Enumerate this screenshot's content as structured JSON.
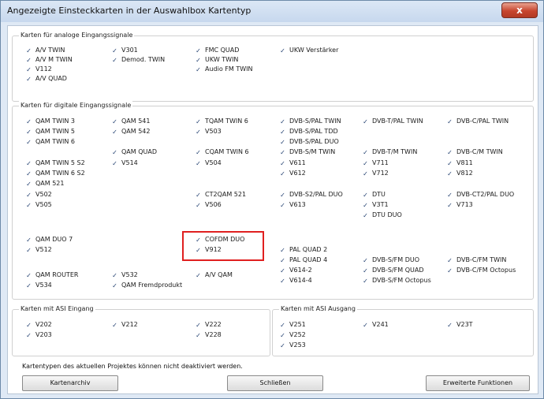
{
  "window": {
    "title": "Angezeigte Einsteckkarten in der Auswahlbox Kartentyp",
    "close_label": "x"
  },
  "check_glyph": "✓",
  "groups": {
    "analog": {
      "title": "Karten für analoge Eingangssignale"
    },
    "digital": {
      "title": "Karten für digitale Eingangssignale"
    },
    "asi_in": {
      "title": "Karten mit ASI Eingang"
    },
    "asi_out": {
      "title": "Karten mit ASI Ausgang"
    }
  },
  "analog_items": [
    {
      "label": "A/V TWIN",
      "checked": true
    },
    {
      "label": "A/V M TWIN",
      "checked": true
    },
    {
      "label": "V112",
      "checked": true
    },
    {
      "label": "A/V QUAD",
      "checked": true
    },
    {
      "label": "V301",
      "checked": true
    },
    {
      "label": "Demod. TWIN",
      "checked": true
    },
    {
      "label": "FMC QUAD",
      "checked": true
    },
    {
      "label": "UKW TWIN",
      "checked": true
    },
    {
      "label": "Audio FM TWIN",
      "checked": true
    },
    {
      "label": "UKW Verstärker",
      "checked": true
    }
  ],
  "digital_items": [
    {
      "label": "QAM TWIN 3",
      "checked": true
    },
    {
      "label": "QAM TWIN 5",
      "checked": true
    },
    {
      "label": "QAM TWIN 6",
      "checked": true
    },
    {
      "label": "QAM TWIN 5 S2",
      "checked": true
    },
    {
      "label": "QAM TWIN 6 S2",
      "checked": true
    },
    {
      "label": "QAM 521",
      "checked": true
    },
    {
      "label": "V502",
      "checked": true
    },
    {
      "label": "V505",
      "checked": true
    },
    {
      "label": "QAM DUO 7",
      "checked": true
    },
    {
      "label": "V512",
      "checked": true
    },
    {
      "label": "QAM ROUTER",
      "checked": true
    },
    {
      "label": "V534",
      "checked": true
    },
    {
      "label": "QAM 541",
      "checked": true
    },
    {
      "label": "QAM 542",
      "checked": true
    },
    {
      "label": "QAM QUAD",
      "checked": true
    },
    {
      "label": "V514",
      "checked": true
    },
    {
      "label": "V532",
      "checked": true
    },
    {
      "label": "QAM Fremdprodukt",
      "checked": true
    },
    {
      "label": "TQAM TWIN 6",
      "checked": true
    },
    {
      "label": "V503",
      "checked": true
    },
    {
      "label": "CQAM TWIN 6",
      "checked": true
    },
    {
      "label": "V504",
      "checked": true
    },
    {
      "label": "CT2QAM 521",
      "checked": true
    },
    {
      "label": "V506",
      "checked": true
    },
    {
      "label": "COFDM DUO",
      "checked": true
    },
    {
      "label": "V912",
      "checked": true
    },
    {
      "label": "A/V QAM",
      "checked": true
    },
    {
      "label": "DVB-S/PAL TWIN",
      "checked": true
    },
    {
      "label": "DVB-S/PAL TDD",
      "checked": true
    },
    {
      "label": "DVB-S/PAL DUO",
      "checked": true
    },
    {
      "label": "DVB-S/M TWIN",
      "checked": true
    },
    {
      "label": "V611",
      "checked": true
    },
    {
      "label": "V612",
      "checked": true
    },
    {
      "label": "DVB-S2/PAL DUO",
      "checked": true
    },
    {
      "label": "V613",
      "checked": true
    },
    {
      "label": "PAL QUAD 2",
      "checked": true
    },
    {
      "label": "PAL QUAD 4",
      "checked": true
    },
    {
      "label": "V614-2",
      "checked": true
    },
    {
      "label": "V614-4",
      "checked": true
    },
    {
      "label": "DVB-T/PAL TWIN",
      "checked": true
    },
    {
      "label": "DVB-T/M TWIN",
      "checked": true
    },
    {
      "label": "V711",
      "checked": true
    },
    {
      "label": "V712",
      "checked": true
    },
    {
      "label": "DTU",
      "checked": true
    },
    {
      "label": "V3T1",
      "checked": true
    },
    {
      "label": "DTU DUO",
      "checked": true
    },
    {
      "label": "DVB-S/FM DUO",
      "checked": true
    },
    {
      "label": "DVB-S/FM QUAD",
      "checked": true
    },
    {
      "label": "DVB-S/FM Octopus",
      "checked": true
    },
    {
      "label": "DVB-C/PAL TWIN",
      "checked": true
    },
    {
      "label": "DVB-C/M TWIN",
      "checked": true
    },
    {
      "label": "V811",
      "checked": true
    },
    {
      "label": "V812",
      "checked": true
    },
    {
      "label": "DVB-CT2/PAL DUO",
      "checked": true
    },
    {
      "label": "V713",
      "checked": true
    },
    {
      "label": "DVB-C/FM TWIN",
      "checked": true
    },
    {
      "label": "DVB-C/FM Octopus",
      "checked": true
    }
  ],
  "asi_in_items": [
    {
      "label": "V202",
      "checked": true
    },
    {
      "label": "V203",
      "checked": true
    },
    {
      "label": "V212",
      "checked": true
    },
    {
      "label": "V222",
      "checked": true
    },
    {
      "label": "V228",
      "checked": true
    }
  ],
  "asi_out_items": [
    {
      "label": "V251",
      "checked": true
    },
    {
      "label": "V252",
      "checked": true
    },
    {
      "label": "V253",
      "checked": true
    },
    {
      "label": "V241",
      "checked": true
    },
    {
      "label": "V23T",
      "checked": true
    }
  ],
  "info_text": "Kartentypen des aktuellen Projektes können nicht deaktiviert werden.",
  "buttons": {
    "archive": "Kartenarchiv",
    "close": "Schließen",
    "advanced": "Erweiterte Funktionen"
  }
}
